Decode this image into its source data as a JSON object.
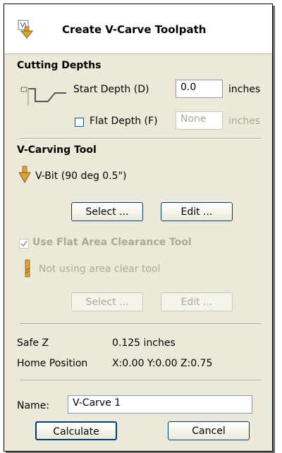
{
  "title": "Create V-Carve Toolpath",
  "cutting_depths": {
    "heading": "Cutting Depths",
    "start_depth_label": "Start Depth (D)",
    "start_depth_value": "0.0",
    "start_depth_unit": "inches",
    "flat_depth_label": "Flat Depth (F)",
    "flat_depth_value": "None",
    "flat_depth_unit": "inches",
    "flat_depth_checked": false
  },
  "vcarving_tool": {
    "heading": "V-Carving Tool",
    "tool_name": "V-Bit (90 deg 0.5\")",
    "select_label": "Select ...",
    "edit_label": "Edit ..."
  },
  "flat_area": {
    "checkbox_label": "Use Flat Area Clearance Tool",
    "checked": true,
    "enabled": false,
    "tool_status": "Not using area clear tool",
    "select_label": "Select ...",
    "edit_label": "Edit ..."
  },
  "positions": {
    "safe_z_label": "Safe Z",
    "safe_z_value": "0.125 inches",
    "home_label": "Home Position",
    "home_value": "X:0.00 Y:0.00 Z:0.75"
  },
  "name_field": {
    "label": "Name:",
    "value": "V-Carve 1"
  },
  "actions": {
    "calculate_label": "Calculate",
    "cancel_label": "Cancel"
  },
  "icons": {
    "title": "vcarve-toolpath-icon",
    "depth": "cutting-depth-diagram-icon",
    "vbit": "v-bit-icon",
    "area_tool": "end-mill-icon"
  },
  "colors": {
    "panel_bg": "#ece9d8",
    "disabled_text": "#aca899",
    "tool_icon": "#c8952a"
  }
}
